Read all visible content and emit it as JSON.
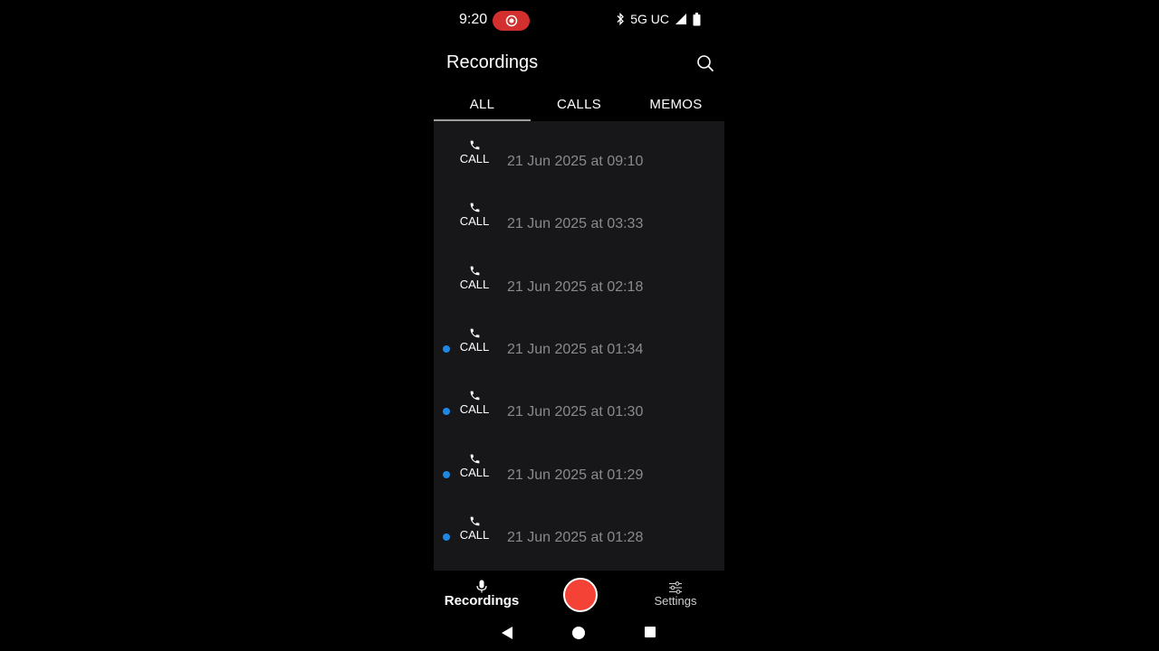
{
  "status_bar": {
    "time": "9:20",
    "network": "5G UC"
  },
  "app_bar": {
    "title": "Recordings"
  },
  "tabs": [
    {
      "label": "ALL",
      "active": true
    },
    {
      "label": "CALLS",
      "active": false
    },
    {
      "label": "MEMOS",
      "active": false
    }
  ],
  "recordings": [
    {
      "type": "CALL",
      "date": "21 Jun 2025 at 09:10",
      "unread": false
    },
    {
      "type": "CALL",
      "date": "21 Jun 2025 at 03:33",
      "unread": false
    },
    {
      "type": "CALL",
      "date": "21 Jun 2025 at 02:18",
      "unread": false
    },
    {
      "type": "CALL",
      "date": "21 Jun 2025 at 01:34",
      "unread": true
    },
    {
      "type": "CALL",
      "date": "21 Jun 2025 at 01:30",
      "unread": true
    },
    {
      "type": "CALL",
      "date": "21 Jun 2025 at 01:29",
      "unread": true
    },
    {
      "type": "CALL",
      "date": "21 Jun 2025 at 01:28",
      "unread": true
    }
  ],
  "bottom_nav": {
    "recordings_label": "Recordings",
    "settings_label": "Settings"
  },
  "colors": {
    "unread_dot": "#1e88e5",
    "record_button": "#f44336",
    "status_pill": "#d32f2f"
  },
  "icons": {
    "search": "search-icon",
    "call": "phone-icon",
    "recordings_tab": "microphone-icon",
    "settings_tab": "sliders-icon"
  }
}
